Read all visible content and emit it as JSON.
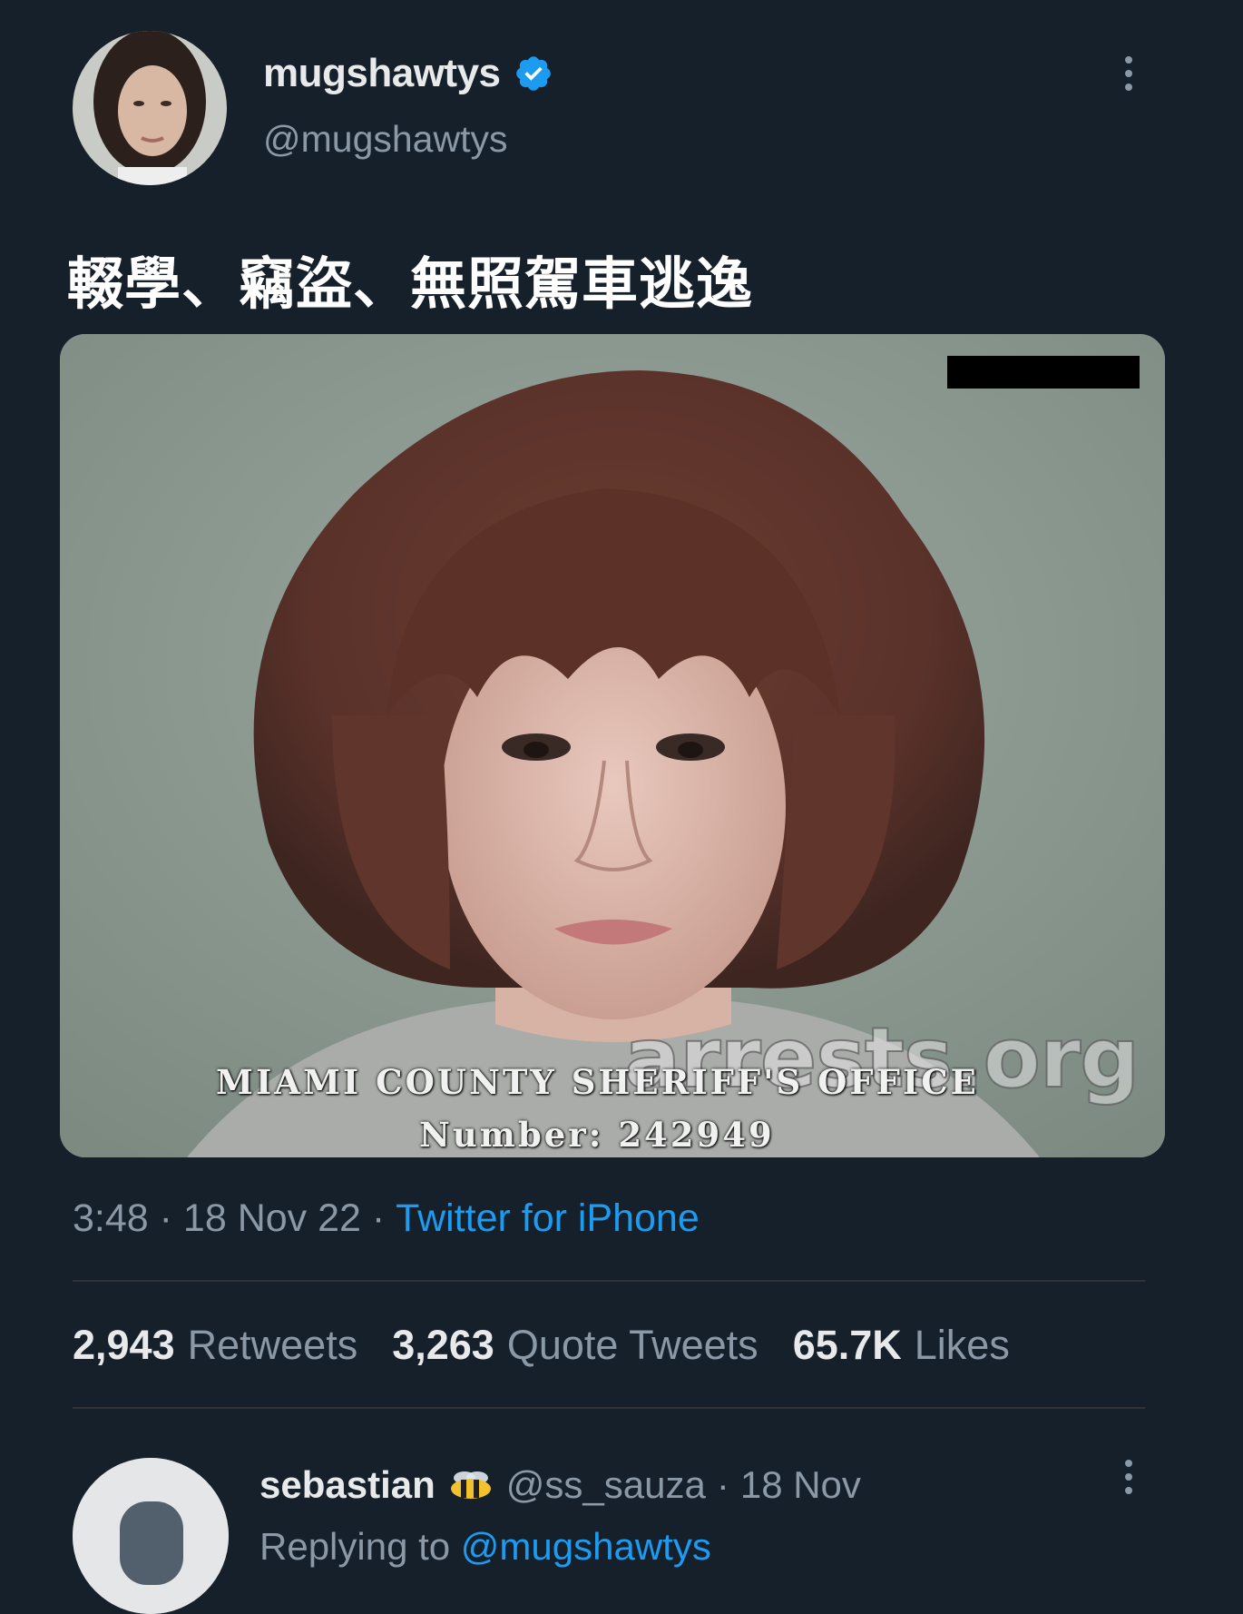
{
  "tweet": {
    "display_name": "mugshawtys",
    "handle": "@mugshawtys",
    "text": "輟學、竊盜、無照駕車逃逸",
    "media": {
      "caption_line1": "MIAMI COUNTY SHERIFF'S OFFICE",
      "caption_line2": "Number: 242949",
      "watermark": "arrests.org"
    },
    "time": "3:48",
    "date": "18 Nov 22",
    "source": "Twitter for iPhone",
    "sep": " · "
  },
  "stats": {
    "retweets_count": "2,943",
    "retweets_label": "Retweets",
    "quotes_count": "3,263",
    "quotes_label": "Quote Tweets",
    "likes_count": "65.7K",
    "likes_label": "Likes"
  },
  "reply": {
    "display_name": "sebastian",
    "handle": "@ss_sauza",
    "date": "18 Nov",
    "sep": "·",
    "replying_prefix": "Replying to",
    "replying_handle": "@mugshawtys"
  },
  "icons": {
    "verified": "verified-badge-icon",
    "more": "more-options-icon",
    "bee_emoji": "bee-emoji-icon"
  },
  "colors": {
    "background": "#15202b",
    "accent": "#1d9bf0",
    "secondary_text": "#8b98a5"
  }
}
